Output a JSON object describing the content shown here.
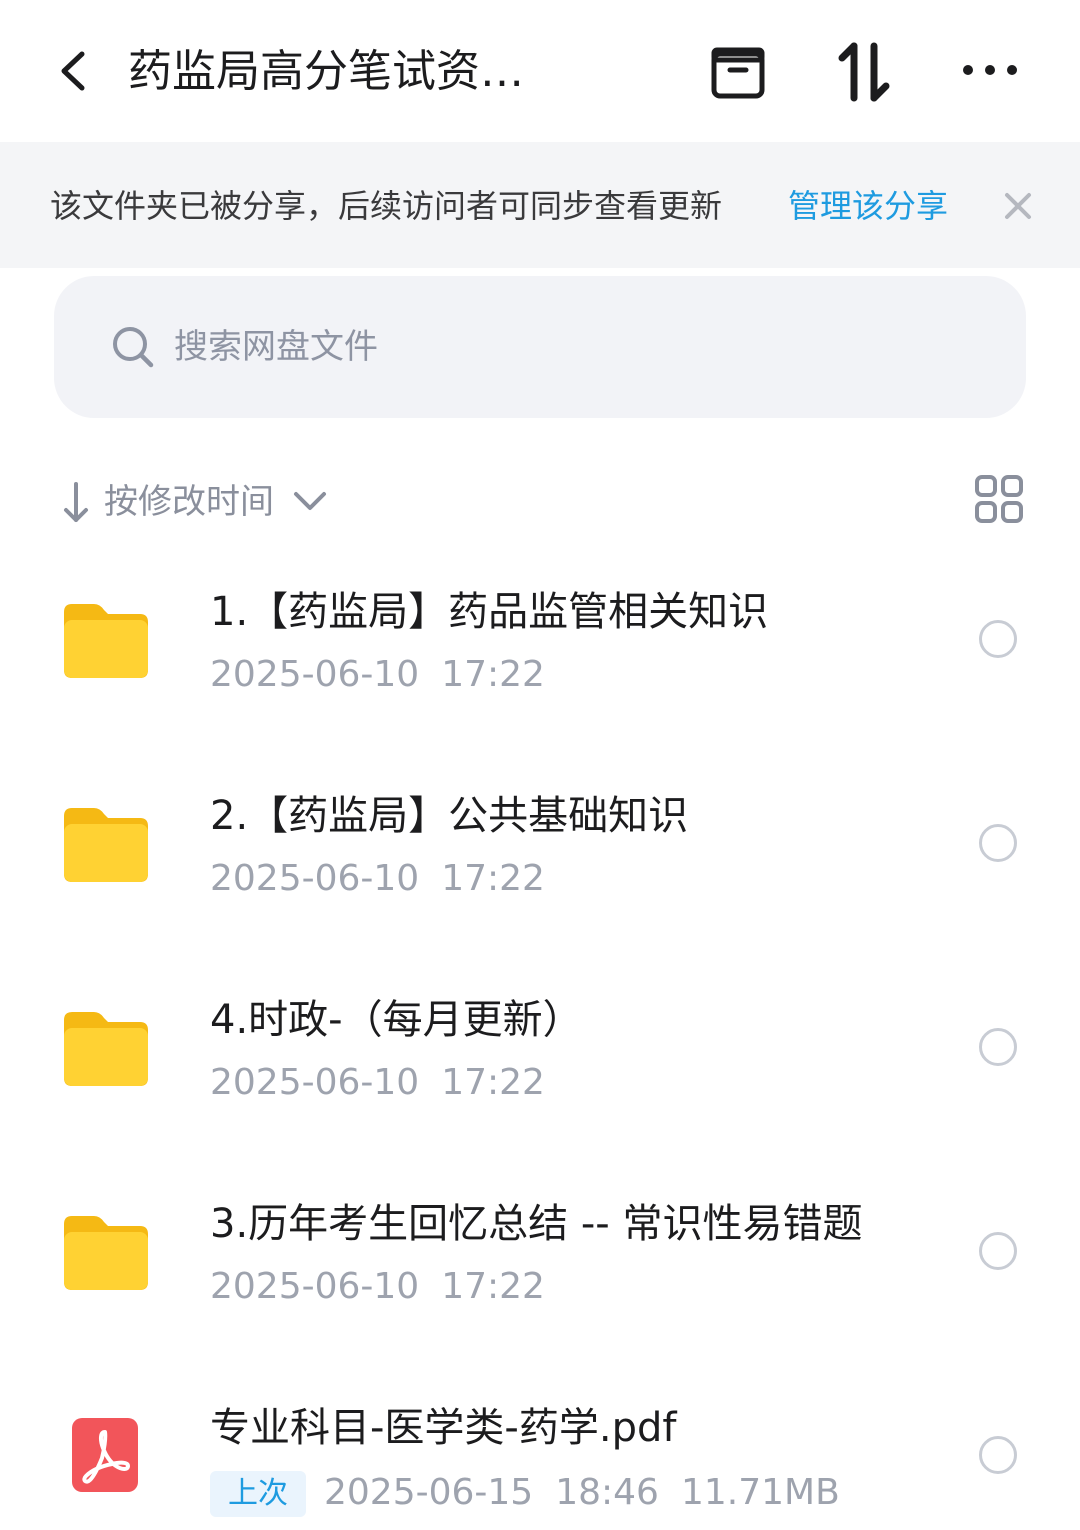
{
  "header": {
    "title": "药监局高分笔试资…",
    "back_icon": "chevron-left-icon",
    "archive_icon": "archive-box-icon",
    "sort_icon": "transfer-sort-icon",
    "more_icon": "more-dots-icon"
  },
  "share_banner": {
    "message": "该文件夹已被分享，后续访问者可同步查看更新",
    "link": "管理该分享",
    "close_icon": "close-icon",
    "link_color": "#1e9be0"
  },
  "search": {
    "placeholder": "搜索网盘文件",
    "value": ""
  },
  "sort": {
    "label": "按修改时间",
    "direction": "descending"
  },
  "files": [
    {
      "name": "1.【药监局】药品监管相关知识",
      "type": "folder",
      "date": "2025-06-10",
      "time": "17:22"
    },
    {
      "name": "2.【药监局】公共基础知识",
      "type": "folder",
      "date": "2025-06-10",
      "time": "17:22"
    },
    {
      "name": "4.时政-（每月更新）",
      "type": "folder",
      "date": "2025-06-10",
      "time": "17:22"
    },
    {
      "name": "3.历年考生回忆总结 -- 常识性易错题",
      "type": "folder",
      "date": "2025-06-10",
      "time": "17:22"
    },
    {
      "name": "专业科目-医学类-药学.pdf",
      "type": "pdf",
      "badge": "上次",
      "date": "2025-06-15",
      "time": "18:46",
      "size": "11.71MB"
    }
  ],
  "colors": {
    "folder": "#ffd233",
    "pdf": "#f2555a",
    "accent": "#1e9be0"
  }
}
